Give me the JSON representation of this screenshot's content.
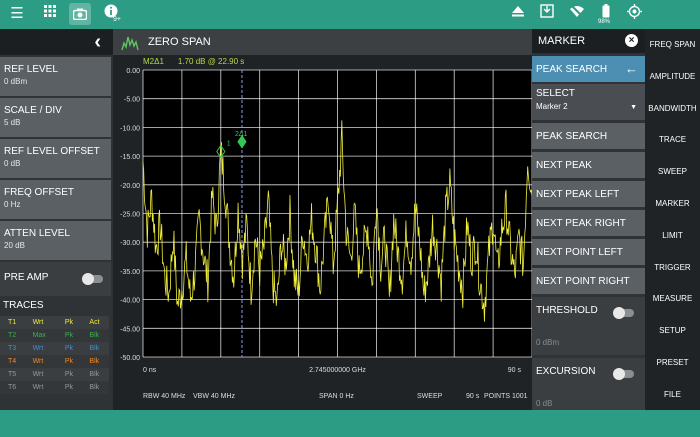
{
  "colors": {
    "accent": "#2d9c85",
    "trace": "#f0ee3a",
    "marker": "#37c655",
    "marker_line": "#8a9cf2",
    "grid": "#ffffff",
    "active": "#4c8fb3"
  },
  "topbar": {
    "icons": [
      "hamburger-menu-icon",
      "grid-apps-icon",
      "camera-icon",
      "info-icon",
      "eject-icon",
      "save-icon",
      "wifi-off-icon",
      "battery-icon",
      "gps-target-icon"
    ],
    "notification_badge": "9+",
    "battery_percent": "98%"
  },
  "left_panel": {
    "params": [
      {
        "label": "REF LEVEL",
        "value": "0 dBm"
      },
      {
        "label": "SCALE / DIV",
        "value": "5 dB"
      },
      {
        "label": "REF LEVEL OFFSET",
        "value": "0 dB"
      },
      {
        "label": "FREQ OFFSET",
        "value": "0 Hz"
      },
      {
        "label": "ATTEN LEVEL",
        "value": "20 dB"
      }
    ],
    "preamp_label": "PRE AMP",
    "traces_label": "TRACES",
    "traces": [
      {
        "name": "T1",
        "mode": "Wrt",
        "detector": "Pk",
        "state": "Act",
        "color": "#f0ee3a"
      },
      {
        "name": "T2",
        "mode": "Max",
        "detector": "Pk",
        "state": "Blk",
        "color": "#3fae56"
      },
      {
        "name": "T3",
        "mode": "Wrt",
        "detector": "Pk",
        "state": "Blk",
        "color": "#3f8fd6"
      },
      {
        "name": "T4",
        "mode": "Wrt",
        "detector": "Pk",
        "state": "Blk",
        "color": "#f08a24"
      },
      {
        "name": "T5",
        "mode": "Wrt",
        "detector": "Pk",
        "state": "Blk",
        "color": "#8f9aa3"
      },
      {
        "name": "T6",
        "mode": "Wrt",
        "detector": "Pk",
        "state": "Blk",
        "color": "#8f9aa3"
      }
    ]
  },
  "chart": {
    "mode_title": "ZERO SPAN",
    "readout_marker": "M2Δ1",
    "readout_value": "1.70 dB @ 22.90 s",
    "x_start": "0 ns",
    "x_center": "2.745000000 GHz",
    "x_end": "90 s",
    "status": {
      "rbw": "RBW 40 MHz",
      "vbw": "VBW 40 MHz",
      "span": "SPAN 0 Hz",
      "sweep": "SWEEP",
      "sweep_time": "90 s",
      "points": "POINTS 1001"
    },
    "markers": [
      {
        "label": "1",
        "time_s": 18.0,
        "level_dbm": -14.2,
        "style": "hollow"
      },
      {
        "label": "2Δ1",
        "time_s": 22.9,
        "level_dbm": -12.5,
        "style": "filled"
      }
    ]
  },
  "chart_data": {
    "type": "line",
    "title": "ZERO SPAN",
    "xlabel": "",
    "ylabel": "",
    "xlim": [
      0,
      90
    ],
    "ylim": [
      -50,
      0
    ],
    "y_ticks": [
      "0.00",
      "-5.00",
      "-10.00",
      "-15.00",
      "-20.00",
      "-25.00",
      "-30.00",
      "-35.00",
      "-40.00",
      "-45.00",
      "-50.00"
    ],
    "grid": true,
    "series": [
      {
        "x": [
          0,
          1,
          2,
          3,
          4,
          5,
          6,
          7,
          8,
          9,
          10,
          11,
          12,
          13,
          14,
          15,
          16,
          17,
          18,
          19,
          20,
          21,
          22,
          23,
          24,
          25,
          26,
          27,
          28,
          29,
          30,
          31,
          32,
          33,
          34,
          35,
          36,
          37,
          38,
          39,
          40,
          41,
          42,
          43,
          44,
          45,
          46,
          47,
          48,
          49,
          50,
          51,
          52,
          53,
          54,
          55,
          56,
          57,
          58,
          59,
          60,
          61,
          62,
          63,
          64,
          65,
          66,
          67,
          68,
          69,
          70,
          71,
          72,
          73,
          74,
          75,
          76,
          77,
          78,
          79,
          80,
          81,
          82,
          83,
          84,
          85,
          86,
          87,
          88,
          89,
          90
        ],
        "values": [
          -16,
          -28,
          -22,
          -31,
          -27,
          -36,
          -39,
          -29,
          -41,
          -38,
          -33,
          -40,
          -35,
          -26,
          -32,
          -37,
          -22,
          -28,
          -14,
          -21,
          -30,
          -36,
          -24,
          -33,
          -27,
          -38,
          -29,
          -35,
          -31,
          -23,
          -37,
          -41,
          -30,
          -34,
          -25,
          -36,
          -39,
          -28,
          -33,
          -26,
          -31,
          -38,
          -29,
          -22,
          -34,
          -24,
          -12,
          -28,
          -33,
          -25,
          -35,
          -31,
          -27,
          -38,
          -22,
          -34,
          -29,
          -40,
          -26,
          -32,
          -36,
          -28,
          -33,
          -24,
          -30,
          -39,
          -35,
          -27,
          -31,
          -37,
          -25,
          -20,
          -29,
          -34,
          -38,
          -27,
          -33,
          -30,
          -37,
          -41,
          -32,
          -26,
          -35,
          -28,
          -24,
          -31,
          -36,
          -29,
          -34,
          -15,
          -22
        ]
      }
    ]
  },
  "marker_panel": {
    "title": "MARKER",
    "active_label": "PEAK SEARCH",
    "select_label": "SELECT",
    "select_value": "Marker 2",
    "buttons": [
      "PEAK SEARCH",
      "NEXT PEAK",
      "NEXT PEAK LEFT",
      "NEXT PEAK RIGHT",
      "NEXT POINT LEFT",
      "NEXT POINT RIGHT"
    ],
    "threshold_label": "THRESHOLD",
    "threshold_value": "0 dBm",
    "excursion_label": "EXCURSION",
    "excursion_value": "0 dB"
  },
  "menu": [
    "FREQ SPAN",
    "AMPLITUDE",
    "BANDWIDTH",
    "TRACE",
    "SWEEP",
    "MARKER",
    "LIMIT",
    "TRIGGER",
    "MEASURE",
    "SETUP",
    "PRESET",
    "FILE"
  ]
}
